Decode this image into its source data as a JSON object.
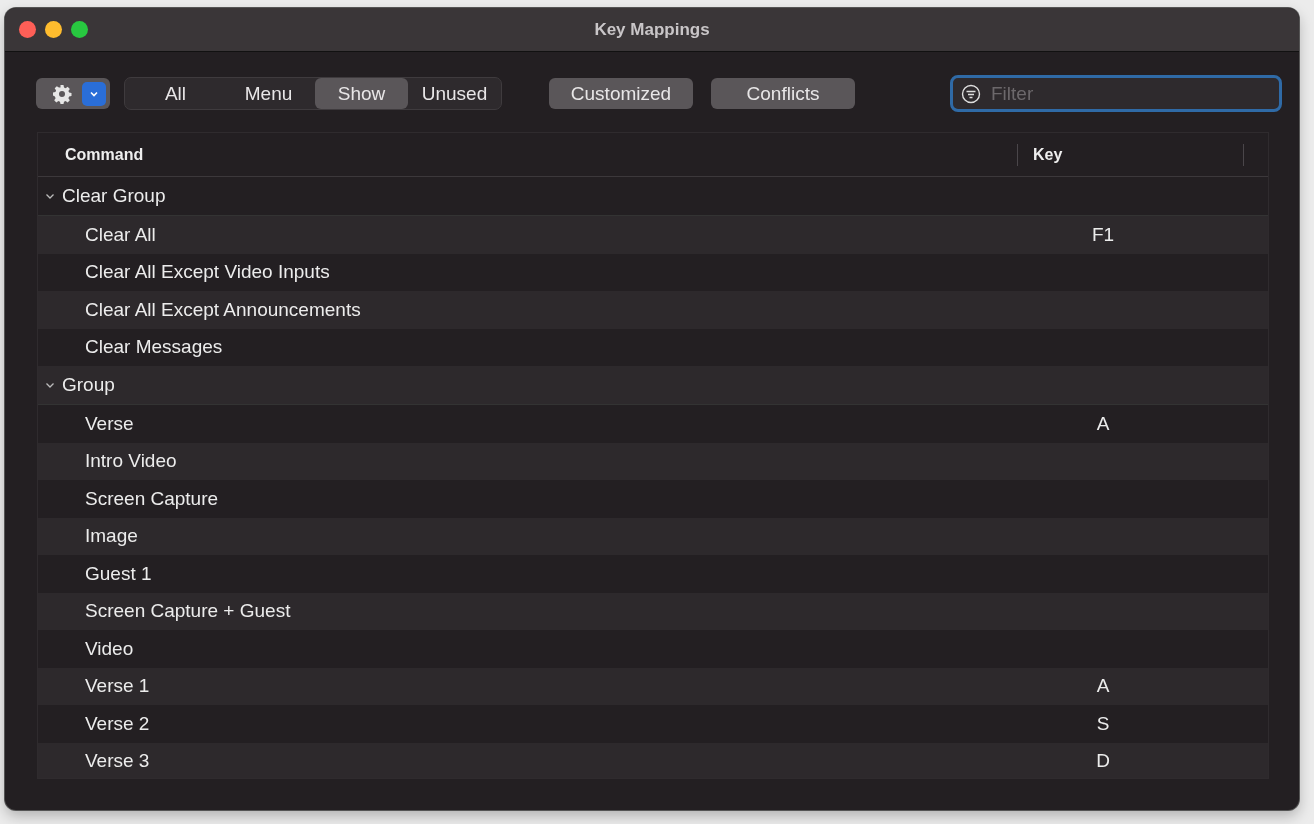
{
  "window": {
    "title": "Key Mappings"
  },
  "toolbar": {
    "segments": [
      {
        "label": "All",
        "selected": false
      },
      {
        "label": "Menu",
        "selected": false
      },
      {
        "label": "Show",
        "selected": true
      },
      {
        "label": "Unused",
        "selected": false
      }
    ],
    "toggles": [
      {
        "label": "Customized",
        "selected": false
      },
      {
        "label": "Conflicts",
        "selected": false
      }
    ],
    "filter": {
      "placeholder": "Filter"
    }
  },
  "table": {
    "columns": [
      "Command",
      "Key"
    ],
    "groups": [
      {
        "name": "Clear Group",
        "expanded": true,
        "children": [
          {
            "command": "Clear All",
            "key": "F1"
          },
          {
            "command": "Clear All Except Video Inputs"
          },
          {
            "command": "Clear All Except Announcements"
          },
          {
            "command": "Clear Messages"
          }
        ]
      },
      {
        "name": "Group",
        "expanded": true,
        "children": [
          {
            "command": "Verse",
            "key": "A"
          },
          {
            "command": "Intro Video"
          },
          {
            "command": "Screen Capture"
          },
          {
            "command": "Image"
          },
          {
            "command": "Guest 1"
          },
          {
            "command": "Screen Capture + Guest"
          },
          {
            "command": "Video"
          },
          {
            "command": "Verse 1",
            "key": "A"
          },
          {
            "command": "Verse 2",
            "key": "S"
          },
          {
            "command": "Verse 3",
            "key": "D"
          }
        ]
      }
    ]
  }
}
